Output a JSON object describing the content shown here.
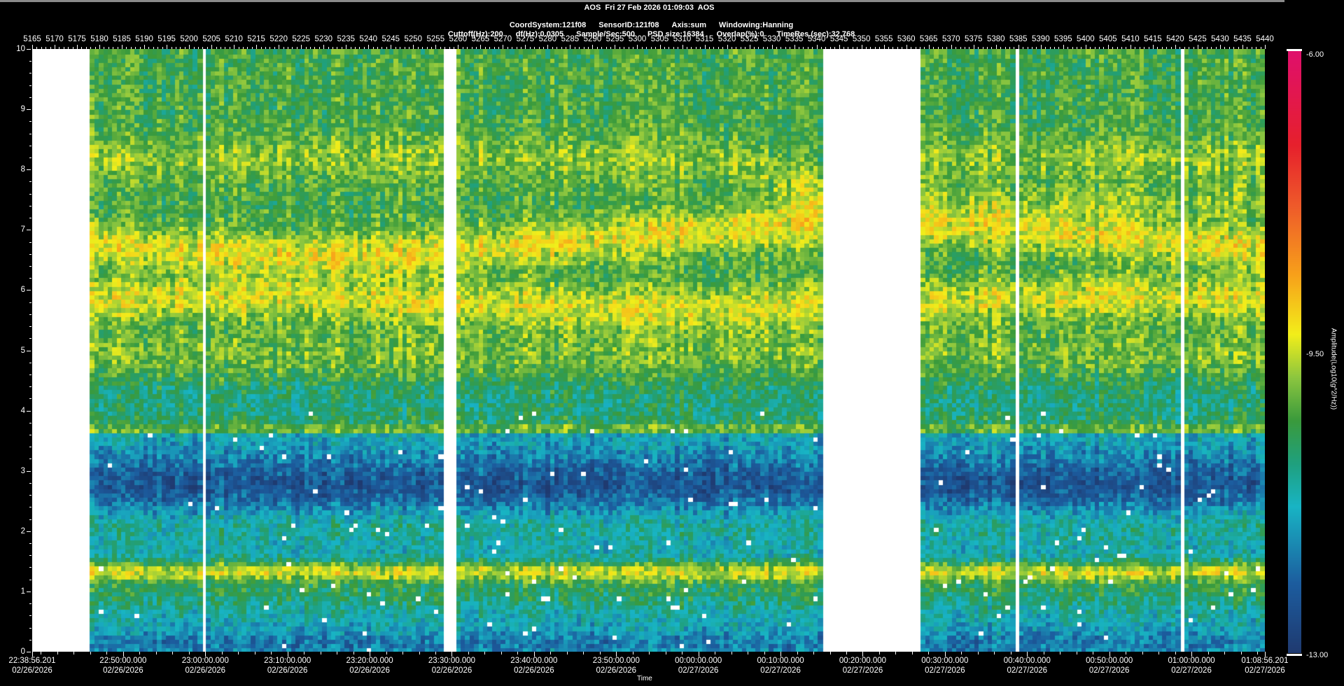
{
  "header": {
    "title": "AOS  Fri 27 Feb 2026 01:09:03  AOS",
    "line2": [
      "CoordSystem:121f08",
      "SensorID:121f08",
      "Axis:sum",
      "Windowing:Hanning"
    ],
    "line3": [
      "Cuttoff(Hz):200",
      "df(Hz):0.0305",
      "Sample/Sec:500",
      "PSD size:16384",
      "Overlap(%):0",
      "TimeRes.(sec):32.768"
    ]
  },
  "chart_data": {
    "type": "heatmap",
    "title": "AOS  Fri 27 Feb 2026 01:09:03  AOS",
    "xlabel": "Time",
    "ylabel": "",
    "x_index_range": [
      5165,
      5440
    ],
    "x_tick_labels": [
      "5165",
      "5170",
      "5175",
      "5180",
      "5185",
      "5190",
      "5195",
      "5200",
      "5205",
      "5210",
      "5215",
      "5220",
      "5225",
      "5230",
      "5235",
      "5240",
      "5245",
      "5250",
      "5255",
      "5260",
      "5265",
      "5270",
      "5275",
      "5280",
      "5285",
      "5290",
      "5295",
      "5300",
      "5305",
      "5310",
      "5315",
      "5320",
      "5325",
      "5330",
      "5335",
      "5340",
      "5345",
      "5350",
      "5355",
      "5360",
      "5365",
      "5370",
      "5375",
      "5380",
      "5385",
      "5390",
      "5395",
      "5400",
      "5405",
      "5410",
      "5415",
      "5420",
      "5425",
      "5430",
      "5435",
      "5440"
    ],
    "y_range": [
      0,
      10
    ],
    "y_tick_labels": [
      "0",
      "1",
      "2",
      "3",
      "4",
      "5",
      "6",
      "7",
      "8",
      "9",
      "10"
    ],
    "time_ticks": [
      {
        "minutes": 0,
        "time": "22:38:56.201",
        "date": "02/26/2026"
      },
      {
        "minutes": 11.063,
        "time": "22:50:00.000",
        "date": "02/26/2026"
      },
      {
        "minutes": 21.063,
        "time": "23:00:00.000",
        "date": "02/26/2026"
      },
      {
        "minutes": 31.063,
        "time": "23:10:00.000",
        "date": "02/26/2026"
      },
      {
        "minutes": 41.063,
        "time": "23:20:00.000",
        "date": "02/26/2026"
      },
      {
        "minutes": 51.063,
        "time": "23:30:00.000",
        "date": "02/26/2026"
      },
      {
        "minutes": 61.063,
        "time": "23:40:00.000",
        "date": "02/26/2026"
      },
      {
        "minutes": 71.063,
        "time": "23:50:00.000",
        "date": "02/26/2026"
      },
      {
        "minutes": 81.063,
        "time": "00:00:00.000",
        "date": "02/27/2026"
      },
      {
        "minutes": 91.063,
        "time": "00:10:00.000",
        "date": "02/27/2026"
      },
      {
        "minutes": 101.063,
        "time": "00:20:00.000",
        "date": "02/27/2026"
      },
      {
        "minutes": 111.063,
        "time": "00:30:00.000",
        "date": "02/27/2026"
      },
      {
        "minutes": 121.063,
        "time": "00:40:00.000",
        "date": "02/27/2026"
      },
      {
        "minutes": 131.063,
        "time": "00:50:00.000",
        "date": "02/27/2026"
      },
      {
        "minutes": 141.063,
        "time": "01:00:00.000",
        "date": "02/27/2026"
      },
      {
        "minutes": 150,
        "time": "01:08:56.201",
        "date": "02/27/2026"
      }
    ],
    "missing_index_ranges": [
      [
        5165,
        5177
      ],
      [
        5203,
        5203
      ],
      [
        5257,
        5259
      ],
      [
        5342,
        5363
      ],
      [
        5385,
        5385
      ],
      [
        5422,
        5422
      ]
    ],
    "bands_hz": [
      {
        "center": 6.8,
        "level": -9.3
      },
      {
        "center": 5.8,
        "level": -9.3
      },
      {
        "center": 8.2,
        "level": -9.9
      },
      {
        "center": 1.35,
        "level": -9.5
      },
      {
        "center": 3.7,
        "level": -10.1
      },
      {
        "center": 2.8,
        "level": -12.4
      }
    ],
    "colorbar": {
      "title": "Amplitude(Log10(g^2/Hz))",
      "min": -13.0,
      "max": -6.0,
      "tick_labels": [
        "-6.00",
        "-9.50",
        "-13.00"
      ],
      "tick_values": [
        -6.0,
        -9.5,
        -13.0
      ],
      "colors": [
        "#1f3a70",
        "#1c5c9e",
        "#18b4c4",
        "#1fa07e",
        "#3a9a3c",
        "#8cc63f",
        "#f2ee1a",
        "#f7a01a",
        "#ee5a2a",
        "#e6202c",
        "#df0f6c"
      ]
    }
  }
}
